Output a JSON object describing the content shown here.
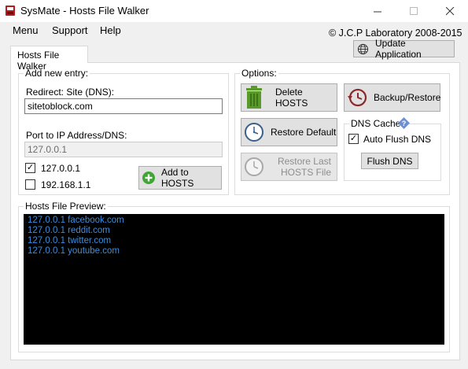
{
  "window": {
    "title": "SysMate - Hosts File Walker"
  },
  "menu": {
    "items": [
      "Menu",
      "Support",
      "Help"
    ],
    "copyright": "© J.C.P Laboratory 2008-2015"
  },
  "toolbar": {
    "update_label": "Update Application"
  },
  "tab": {
    "label": "Hosts File Walker"
  },
  "add_entry": {
    "group_label": "Add new entry:",
    "redirect_label": "Redirect: Site (DNS):",
    "redirect_value": "sitetoblock.com",
    "port_label": "Port to IP Address/DNS:",
    "port_value": "127.0.0.1",
    "ip_options": [
      {
        "label": "127.0.0.1",
        "checked": true
      },
      {
        "label": "192.168.1.1",
        "checked": false
      }
    ],
    "add_button": "Add to HOSTS"
  },
  "options": {
    "group_label": "Options:",
    "delete_button": "Delete HOSTS",
    "backup_button": "Backup/Restore",
    "restore_default_button": "Restore Default",
    "restore_last_line1": "Restore Last",
    "restore_last_line2": "HOSTS File",
    "dns_cache_label": "DNS Cache",
    "auto_flush_label": "Auto Flush DNS",
    "auto_flush_checked": true,
    "flush_button": "Flush DNS"
  },
  "preview": {
    "group_label": "Hosts File Preview:",
    "lines": [
      "127.0.0.1 facebook.com",
      "127.0.0.1 reddit.com",
      "127.0.0.1 twitter.com",
      "127.0.0.1 youtube.com"
    ]
  },
  "colors": {
    "preview_bg": "#000000",
    "preview_text": "#3e8ddd",
    "trash_green": "#5a9a2a",
    "add_green": "#3fa535",
    "clock_red": "#8b2a2a",
    "help_blue": "#6f8fd0"
  }
}
